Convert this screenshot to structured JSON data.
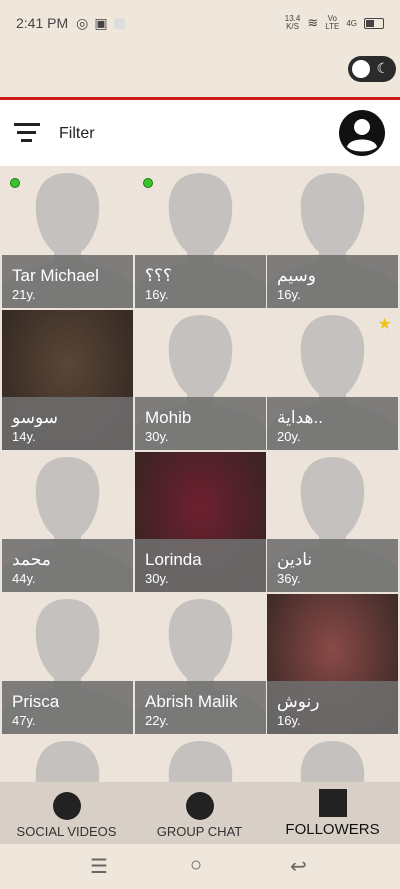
{
  "status": {
    "time": "2:41 PM",
    "speed_top": "13.4",
    "speed_bottom": "K/S",
    "net_top": "Vo",
    "net_bottom": "LTE",
    "signal": "4G"
  },
  "filter": {
    "label": "Filter"
  },
  "users": [
    {
      "name": "Tar Michael",
      "age": "21y.",
      "online": true,
      "photo": false
    },
    {
      "name": "؟؟؟",
      "age": "16y.",
      "online": true,
      "photo": false
    },
    {
      "name": "وسيم",
      "age": "16y.",
      "online": false,
      "photo": false
    },
    {
      "name": "سوسو",
      "age": "14y.",
      "online": false,
      "photo": true,
      "photo_color": "#5a4636"
    },
    {
      "name": "Mohib",
      "age": "30y.",
      "online": false,
      "photo": false
    },
    {
      "name": "هداية..",
      "age": "20y.",
      "online": false,
      "photo": false,
      "star": true
    },
    {
      "name": "محمد",
      "age": "44y.",
      "online": false,
      "photo": false
    },
    {
      "name": "Lorinda",
      "age": "30y.",
      "online": false,
      "photo": true,
      "photo_color": "#6e2030"
    },
    {
      "name": "نادين",
      "age": "36y.",
      "online": false,
      "photo": false
    },
    {
      "name": "Prisca",
      "age": "47y.",
      "online": false,
      "photo": false
    },
    {
      "name": "Abrish Malik",
      "age": "22y.",
      "online": false,
      "photo": false
    },
    {
      "name": "رنوش",
      "age": "16y.",
      "online": false,
      "photo": true,
      "photo_color": "#8a4a48"
    }
  ],
  "nav": {
    "social_videos": "SOCIAL VIDEOS",
    "group_chat": "GROUP CHAT",
    "followers": "FOLLOWERS"
  },
  "colors": {
    "accent": "#d11a1a",
    "online": "#3cc22a",
    "star": "#f2c21b"
  }
}
